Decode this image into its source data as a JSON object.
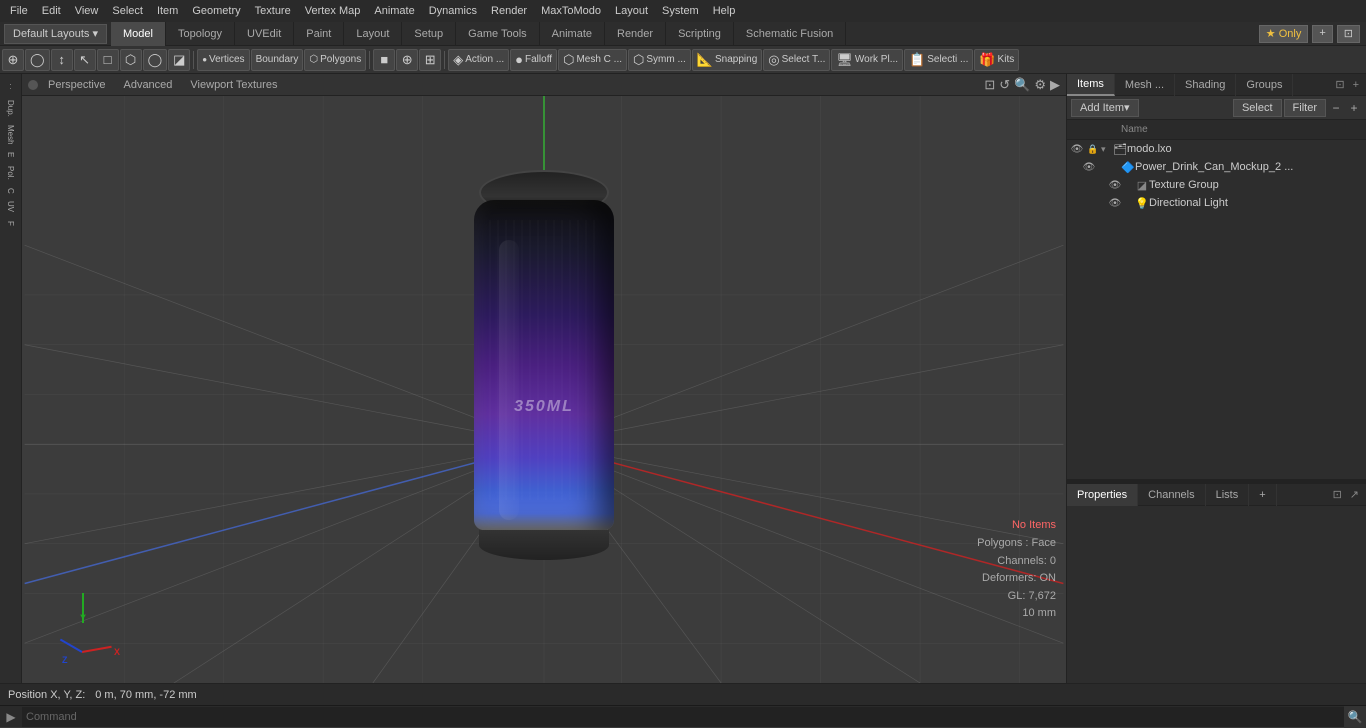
{
  "menu": {
    "items": [
      "File",
      "Edit",
      "View",
      "Select",
      "Item",
      "Geometry",
      "Texture",
      "Vertex Map",
      "Animate",
      "Dynamics",
      "Render",
      "MaxToModo",
      "Layout",
      "System",
      "Help"
    ]
  },
  "layout_bar": {
    "dropdown_label": "Default Layouts ▾",
    "tabs": [
      "Model",
      "Topology",
      "UVEdit",
      "Paint",
      "Layout",
      "Setup",
      "Game Tools",
      "Animate",
      "Render",
      "Scripting",
      "Schematic Fusion"
    ],
    "active_tab": "Model",
    "right_buttons": [
      "★ Only",
      "+"
    ]
  },
  "toolbar": {
    "left_buttons": [
      {
        "icon": "⊹",
        "label": ""
      },
      {
        "icon": "⊕",
        "label": ""
      },
      {
        "icon": "△",
        "label": ""
      },
      {
        "icon": "↕",
        "label": ""
      },
      {
        "icon": "□",
        "label": ""
      },
      {
        "icon": "⬡",
        "label": ""
      },
      {
        "icon": "◯",
        "label": ""
      },
      {
        "icon": "◪",
        "label": ""
      }
    ],
    "mode_buttons": [
      "Vertices",
      "Boundary",
      "Polygons"
    ],
    "tool_buttons": [
      {
        "icon": "■",
        "label": ""
      },
      {
        "icon": "⊕",
        "label": ""
      },
      {
        "icon": "⊞",
        "label": ""
      },
      {
        "icon": "◈",
        "label": "Action ..."
      },
      {
        "icon": "●",
        "label": "Falloff"
      },
      {
        "icon": "⬡",
        "label": "Mesh C ..."
      },
      {
        "icon": "⬡",
        "label": "Symm ..."
      },
      {
        "icon": "📐",
        "label": "Snapping"
      },
      {
        "icon": "◎",
        "label": "Select T..."
      },
      {
        "icon": "🖥",
        "label": "Work Pl..."
      },
      {
        "icon": "📋",
        "label": "Selecti ..."
      },
      {
        "icon": "🎁",
        "label": "Kits"
      }
    ]
  },
  "viewport": {
    "dot_color": "#777",
    "tabs": [
      "Perspective",
      "Advanced",
      "Viewport Textures"
    ],
    "active_tab": "Perspective",
    "info": {
      "no_items": "No Items",
      "polygons": "Polygons : Face",
      "channels": "Channels: 0",
      "deformers": "Deformers: ON",
      "gl": "GL: 7,672",
      "grid": "10 mm"
    }
  },
  "right_panel": {
    "tabs": [
      "Items",
      "Mesh ...",
      "Shading",
      "Groups"
    ],
    "active_tab": "Items",
    "item_toolbar": {
      "add_item_label": "Add Item",
      "dropdown_icon": "▾",
      "select_label": "Select",
      "filter_label": "Filter",
      "collapse_label": "−",
      "expand_label": "+"
    },
    "item_list_header": {
      "name_col": "Name"
    },
    "items": [
      {
        "id": "modo-lxo",
        "name": "modo.lxo",
        "indent": 0,
        "icon": "🗂",
        "expanded": true,
        "vis": true
      },
      {
        "id": "power-drink",
        "name": "Power_Drink_Can_Mockup_2 ...",
        "indent": 1,
        "icon": "🔷",
        "vis": true
      },
      {
        "id": "texture-group",
        "name": "Texture Group",
        "indent": 2,
        "icon": "◪",
        "vis": true
      },
      {
        "id": "directional-light",
        "name": "Directional Light",
        "indent": 2,
        "icon": "💡",
        "vis": true
      }
    ]
  },
  "properties_panel": {
    "tabs": [
      "Properties",
      "Channels",
      "Lists",
      "+"
    ],
    "active_tab": "Properties"
  },
  "status_bar": {
    "position_label": "Position X, Y, Z:",
    "position_value": "0 m, 70 mm, -72 mm"
  },
  "command_bar": {
    "arrow": "▶",
    "placeholder": "Command",
    "search_icon": "🔍"
  }
}
